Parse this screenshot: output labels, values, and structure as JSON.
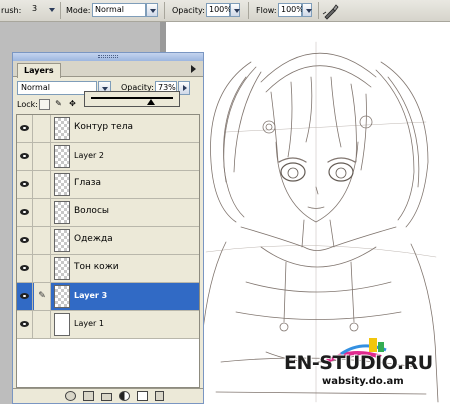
{
  "options_bar": {
    "brush_label": "rush:",
    "brush_size": "3",
    "mode_label": "Mode:",
    "mode_value": "Normal",
    "opacity_label": "Opacity:",
    "opacity_value": "100%",
    "flow_label": "Flow:",
    "flow_value": "100%"
  },
  "layers_panel": {
    "tab_label": "Layers",
    "blend_mode": "Normal",
    "opacity_label": "Opacity:",
    "opacity_value": "73%",
    "opacity_slider_fraction": 0.73,
    "lock_label": "Lock:",
    "layers": [
      {
        "name": "Контур тела",
        "visible": true,
        "selected": false,
        "thumb": "transparent"
      },
      {
        "name": "Layer 2",
        "visible": true,
        "selected": false,
        "thumb": "transparent"
      },
      {
        "name": "Глаза",
        "visible": true,
        "selected": false,
        "thumb": "transparent"
      },
      {
        "name": "Волосы",
        "visible": true,
        "selected": false,
        "thumb": "transparent"
      },
      {
        "name": "Одежда",
        "visible": true,
        "selected": false,
        "thumb": "transparent"
      },
      {
        "name": "Тон кожи",
        "visible": true,
        "selected": false,
        "thumb": "transparent"
      },
      {
        "name": "Layer 3",
        "visible": true,
        "selected": true,
        "thumb": "transparent"
      },
      {
        "name": "Layer 1",
        "visible": true,
        "selected": false,
        "thumb": "white"
      }
    ],
    "selection_color": "#316ac5"
  },
  "watermark": {
    "logo": "EN-STUDIO.RU",
    "site": "wabsity.do.am"
  }
}
